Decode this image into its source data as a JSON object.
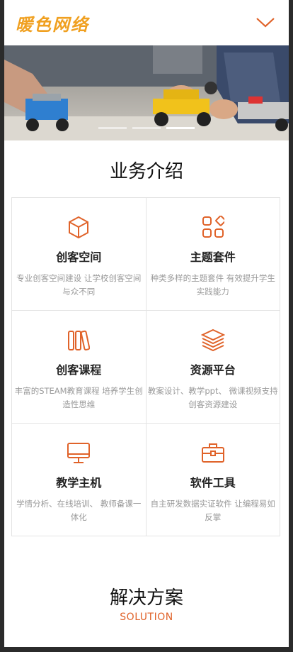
{
  "header": {
    "logo_text": "暖色网络",
    "menu_icon": "chevron-down-icon"
  },
  "banner": {
    "slides": 3,
    "active_slide": 3
  },
  "services": {
    "title": "业务介绍",
    "items": [
      {
        "icon": "cube-icon",
        "name": "创客空间",
        "desc": "专业创客空间建设 让学校创客空间与众不同"
      },
      {
        "icon": "grid-shapes-icon",
        "name": "主题套件",
        "desc": "种类多样的主题套件 有效提升学生实践能力"
      },
      {
        "icon": "books-icon",
        "name": "创客课程",
        "desc": "丰富的STEAM教育课程 培养学生创造性思维"
      },
      {
        "icon": "layers-icon",
        "name": "资源平台",
        "desc": "教案设计、教学ppt、 微课视频支持创客资源建设"
      },
      {
        "icon": "monitor-icon",
        "name": "教学主机",
        "desc": "学情分析、在线培训、 教师备课一体化"
      },
      {
        "icon": "toolbox-icon",
        "name": "软件工具",
        "desc": "自主研发数据实证软件 让编程易如反掌"
      }
    ]
  },
  "solution": {
    "title": "解决方案",
    "subtitle": "SOLUTION"
  },
  "colors": {
    "accent": "#e0632a",
    "logo": "#f0a020"
  }
}
